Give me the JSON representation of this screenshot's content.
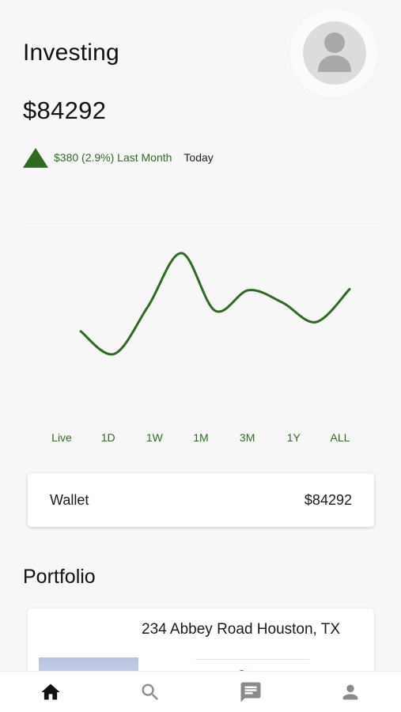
{
  "header": {
    "title": "Investing",
    "avatar_icon": "user-avatar-icon"
  },
  "balance": {
    "amount": "$84292",
    "change_text": "$380 (2.9%) Last Month",
    "period": "Today",
    "trend": "up",
    "trend_color": "#2e6b22"
  },
  "chart": {
    "line_color": "#2e6b22"
  },
  "chart_data": {
    "type": "line",
    "title": "",
    "xlabel": "",
    "ylabel": "",
    "x": [
      0,
      1,
      2,
      3,
      4,
      5,
      6,
      7,
      8
    ],
    "values": [
      24,
      2,
      48,
      100,
      44,
      64,
      52,
      33,
      65
    ],
    "ylim": [
      0,
      100
    ],
    "grid": false,
    "legend": "none"
  },
  "ranges": {
    "items": [
      "Live",
      "1D",
      "1W",
      "1M",
      "3M",
      "1Y",
      "ALL"
    ]
  },
  "wallet": {
    "label": "Wallet",
    "value": "$84292"
  },
  "portfolio": {
    "title": "Portfolio",
    "property": {
      "address": "234 Abbey Road Houston, TX"
    }
  },
  "bottom_nav": {
    "items": [
      {
        "icon": "home-icon",
        "active": true
      },
      {
        "icon": "search-icon",
        "active": false
      },
      {
        "icon": "message-icon",
        "active": false
      },
      {
        "icon": "person-icon",
        "active": false
      }
    ],
    "active_color": "#111111",
    "inactive_color": "#8a8a8a"
  }
}
